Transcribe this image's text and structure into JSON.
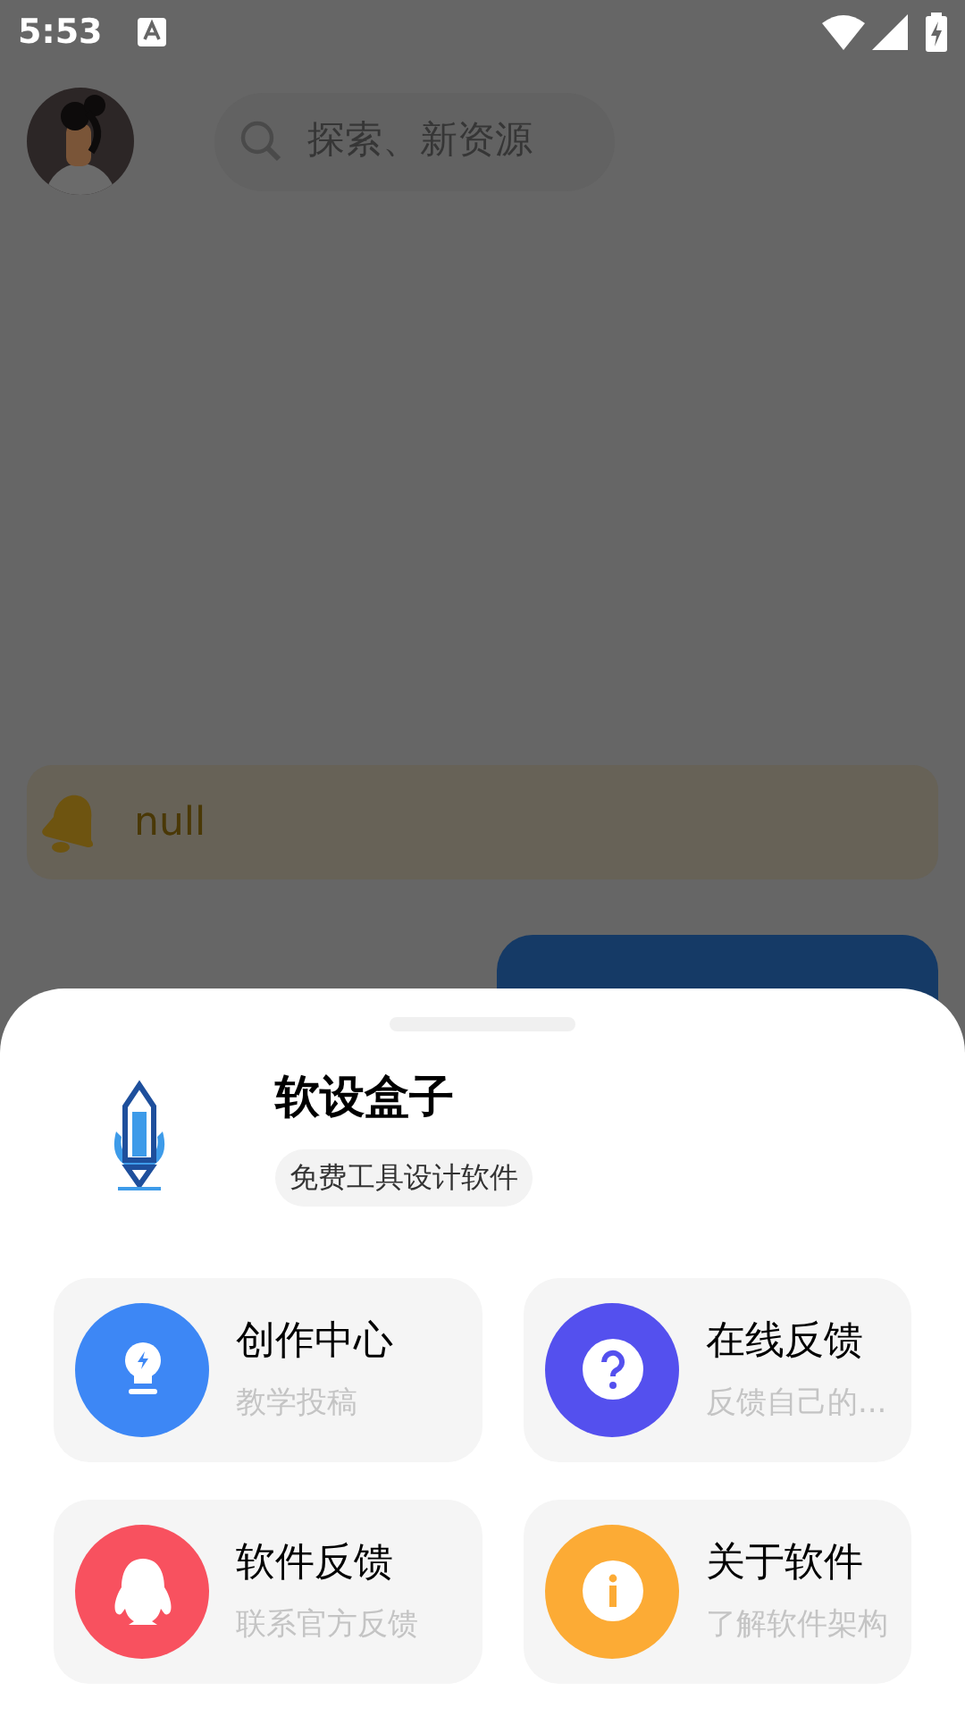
{
  "status_bar": {
    "time": "5:53"
  },
  "search": {
    "placeholder": "探索、新资源"
  },
  "notice": {
    "text": "null"
  },
  "sheet": {
    "app_name": "软设盒子",
    "tagline": "免费工具设计软件",
    "items": [
      {
        "title": "创作中心",
        "subtitle": "教学投稿",
        "kind": "bulb",
        "color": "#3d87f5"
      },
      {
        "title": "在线反馈",
        "subtitle": "反馈自己的...",
        "kind": "question",
        "color": "#5450ee"
      },
      {
        "title": "软件反馈",
        "subtitle": "联系官方反馈",
        "kind": "penguin",
        "color": "#f8515f"
      },
      {
        "title": "关于软件",
        "subtitle": "了解软件架构",
        "kind": "info",
        "color": "#fcab35"
      }
    ]
  }
}
